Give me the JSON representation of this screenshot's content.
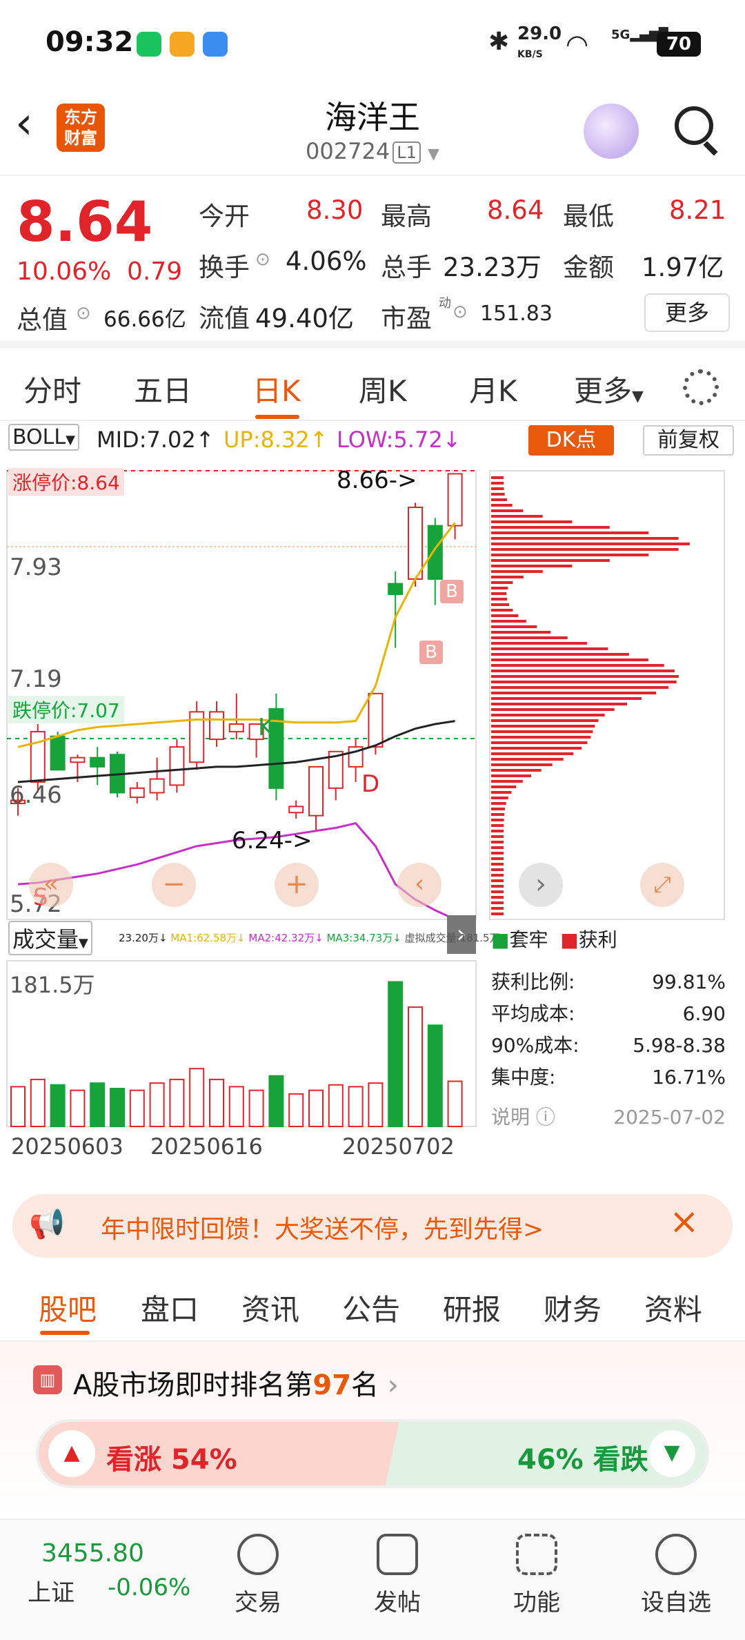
{
  "status": {
    "time": "09:32",
    "net_speed": "29.0",
    "net_unit": "KB/S",
    "signal": "5G",
    "battery": "70"
  },
  "nav": {
    "title": "海洋王",
    "code": "002724",
    "level": "L1",
    "logo_line1": "东方",
    "logo_line2": "财富"
  },
  "quote": {
    "price": "8.64",
    "change_pct": "10.06%",
    "change": "0.79",
    "open_label": "今开",
    "open": "8.30",
    "high_label": "最高",
    "high": "8.64",
    "low_label": "最低",
    "low": "8.21",
    "turnover_label": "换手",
    "turnover": "4.06%",
    "volume_label": "总手",
    "volume": "23.23万",
    "amount_label": "金额",
    "amount": "1.97亿",
    "mktcap_label": "总值",
    "mktcap": "66.66亿",
    "float_label": "流值",
    "float": "49.40亿",
    "pe_label": "市盈",
    "pe_sup": "动",
    "pe": "151.83",
    "more": "更多"
  },
  "tabs": [
    "分时",
    "五日",
    "日K",
    "周K",
    "月K",
    "更多"
  ],
  "chart": {
    "indicator": "BOLL",
    "mid": "MID:7.02↑",
    "up": "UP:8.32↑",
    "low": "LOW:5.72↓",
    "dk_button": "DK点",
    "adjust_button": "前复权",
    "limit_up_label": "涨停价:8.64",
    "limit_down_label": "跌停价:7.07",
    "y_labels": [
      "8.66",
      "7.93",
      "7.19",
      "6.46",
      "5.72"
    ],
    "marker_high": "8.66->",
    "marker_low": "6.24->",
    "marker_k": "K",
    "marker_d": "D",
    "marker_s": "S",
    "marker_b": "B",
    "volume_label": "成交量",
    "vol_legend": [
      "23.20万↓",
      "MA1:62.58万↓",
      "MA2:42.32万↓",
      "MA3:34.73万↓",
      "虚拟成交量:181.5万"
    ],
    "vol_max": "181.5万",
    "dates": [
      "20250603",
      "20250616",
      "20250702"
    ],
    "colors": {
      "up": "#e0242a",
      "down": "#16a33a",
      "mid": "#222222",
      "upper": "#e8b400",
      "lower": "#c62ec8"
    }
  },
  "chip": {
    "legend_trapped": "套牢",
    "legend_profit": "获利",
    "rows": [
      {
        "label": "获利比例:",
        "value": "99.81%"
      },
      {
        "label": "平均成本:",
        "value": "6.90"
      },
      {
        "label": "90%成本:",
        "value": "5.98-8.38"
      },
      {
        "label": "集中度:",
        "value": "16.71%"
      }
    ],
    "note_label": "说明",
    "date": "2025-07-02"
  },
  "ad": {
    "text": "年中限时回馈！大奖送不停，先到先得>"
  },
  "bottom_tabs": [
    "股吧",
    "盘口",
    "资讯",
    "公告",
    "研报",
    "财务",
    "资料"
  ],
  "ranking": {
    "prefix": "A股市场即时排名第",
    "rank": "97",
    "suffix": "名",
    "bull_label": "看涨 54%",
    "bear_label": "46% 看跌",
    "bull_pct": 54
  },
  "toolbar": {
    "index_value": "3455.80",
    "index_name": "上证",
    "index_change": "-0.06%",
    "items": [
      "交易",
      "发帖",
      "功能",
      "设自选"
    ]
  },
  "chart_data": {
    "type": "candlestick",
    "ylim": [
      5.72,
      8.66
    ],
    "ohlc": [
      [
        6.48,
        6.58,
        6.4,
        6.5
      ],
      [
        6.62,
        7.0,
        6.55,
        6.95
      ],
      [
        6.92,
        6.95,
        6.7,
        6.7
      ],
      [
        6.75,
        6.8,
        6.62,
        6.78
      ],
      [
        6.78,
        6.85,
        6.6,
        6.72
      ],
      [
        6.8,
        6.82,
        6.52,
        6.55
      ],
      [
        6.52,
        6.62,
        6.48,
        6.58
      ],
      [
        6.55,
        6.78,
        6.5,
        6.64
      ],
      [
        6.6,
        6.9,
        6.55,
        6.85
      ],
      [
        6.75,
        7.15,
        6.7,
        7.08
      ],
      [
        6.9,
        7.15,
        6.85,
        7.08
      ],
      [
        6.95,
        7.2,
        6.9,
        7.0
      ],
      [
        6.9,
        7.0,
        6.78,
        7.0
      ],
      [
        7.1,
        7.2,
        6.5,
        6.58
      ],
      [
        6.42,
        6.5,
        6.38,
        6.46
      ],
      [
        6.4,
        6.72,
        6.3,
        6.72
      ],
      [
        6.58,
        6.82,
        6.5,
        6.82
      ],
      [
        6.72,
        6.9,
        6.62,
        6.85
      ],
      [
        6.85,
        7.2,
        6.8,
        7.2
      ],
      [
        7.92,
        8.0,
        7.5,
        7.85
      ],
      [
        7.95,
        8.45,
        7.9,
        8.42
      ],
      [
        8.3,
        8.35,
        7.78,
        7.95
      ],
      [
        8.3,
        8.64,
        8.21,
        8.64
      ]
    ],
    "volume": [
      1.1,
      1.3,
      1.15,
      1.0,
      1.2,
      1.05,
      1.0,
      1.2,
      1.3,
      1.6,
      1.3,
      1.1,
      1.0,
      1.4,
      0.9,
      1.0,
      1.15,
      1.1,
      1.2,
      4.0,
      3.3,
      2.8,
      1.25
    ],
    "mid": [
      6.62,
      6.63,
      6.64,
      6.65,
      6.66,
      6.67,
      6.68,
      6.69,
      6.7,
      6.71,
      6.72,
      6.72,
      6.73,
      6.74,
      6.75,
      6.77,
      6.79,
      6.82,
      6.86,
      6.92,
      6.97,
      7.0,
      7.02
    ],
    "upper": [
      6.85,
      6.88,
      6.92,
      6.96,
      6.98,
      6.99,
      7.0,
      7.01,
      7.02,
      7.03,
      7.03,
      7.03,
      7.03,
      7.02,
      7.01,
      7.01,
      7.01,
      7.02,
      7.25,
      7.7,
      7.95,
      8.15,
      8.32
    ],
    "lower": [
      5.95,
      5.96,
      5.98,
      6.0,
      6.02,
      6.05,
      6.08,
      6.12,
      6.16,
      6.2,
      6.22,
      6.24,
      6.25,
      6.26,
      6.28,
      6.3,
      6.32,
      6.35,
      6.2,
      5.95,
      5.85,
      5.78,
      5.72
    ]
  }
}
